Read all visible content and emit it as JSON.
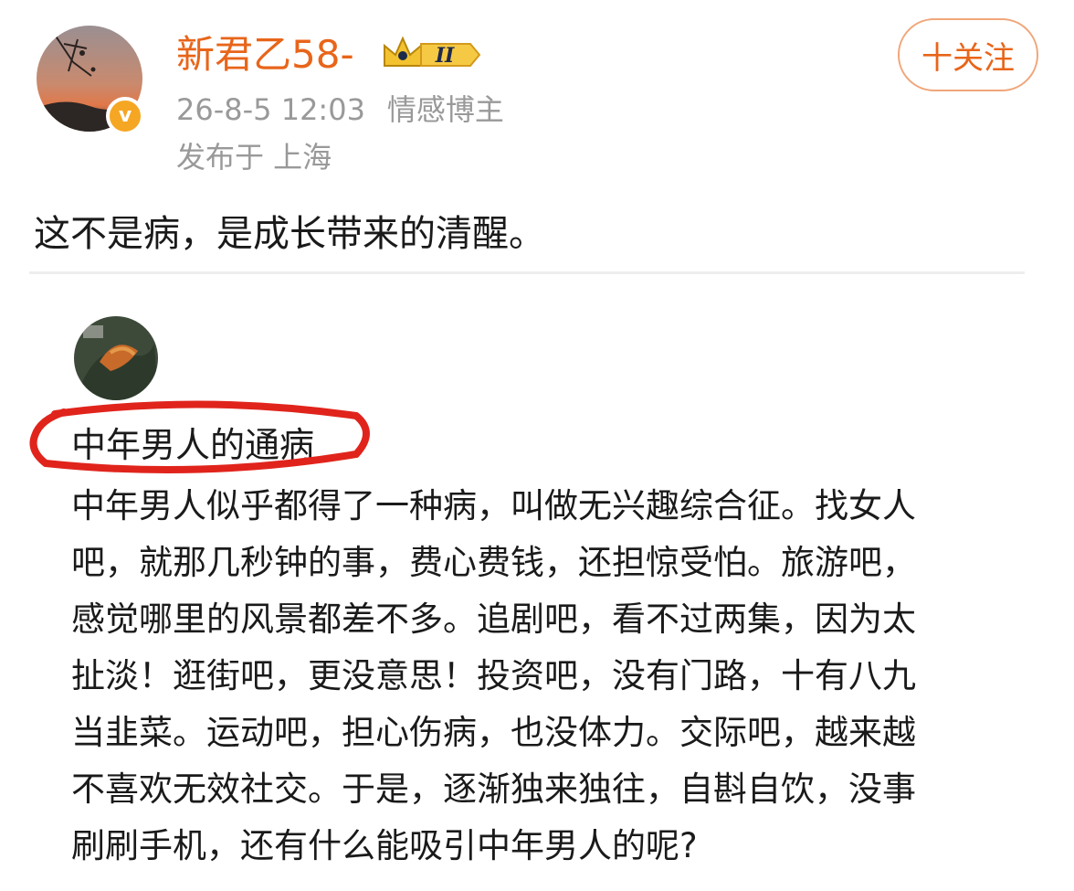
{
  "post": {
    "username": "新君乙58-",
    "level_badge": "II",
    "verified_badge": "v",
    "timestamp": "26-8-5 12:03",
    "role": "情感博主",
    "location": "发布于 上海",
    "follow_label": "十关注",
    "text": "这不是病，是成长带来的清醒。"
  },
  "quoted": {
    "title": "中年男人的通病",
    "body_lines": [
      "中年男人似乎都得了一种病，叫做无兴趣综合征。找女人",
      "吧，就那几秒钟的事，费心费钱，还担惊受怕。旅游吧，",
      "感觉哪里的风景都差不多。追剧吧，看不过两集，因为太",
      "扯淡！逛街吧，更没意思！投资吧，没有门路，十有八九",
      "当韭菜。运动吧，担心伤病，也没体力。交际吧，越来越",
      "不喜欢无效社交。于是，逐渐独来独往，自斟自饮，没事",
      "刷刷手机，还有什么能吸引中年男人的呢?"
    ]
  },
  "colors": {
    "username": "#e8651a",
    "meta": "#999999",
    "annotation": "#e0241c"
  },
  "icons": {
    "verified": "verified-v-icon",
    "level": "crown-level-icon"
  }
}
